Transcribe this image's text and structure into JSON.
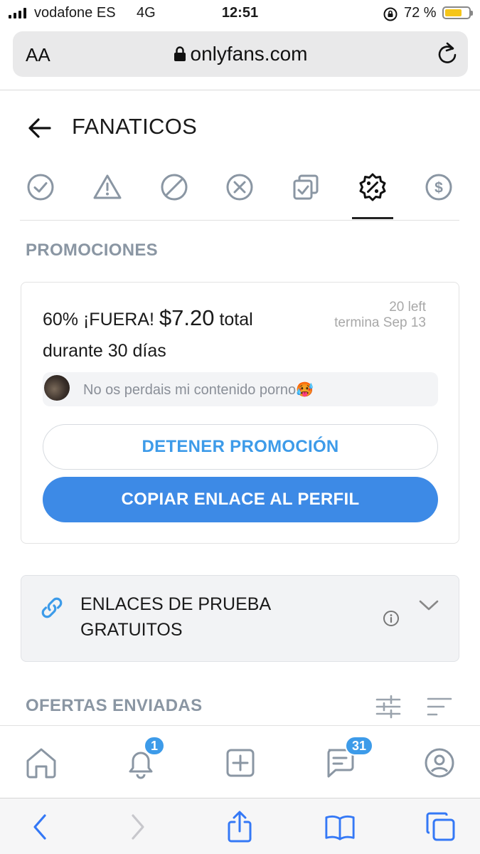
{
  "status_bar": {
    "carrier": "vodafone ES",
    "network": "4G",
    "time": "12:51",
    "battery_percent": "72 %",
    "battery_level": 0.72
  },
  "browser": {
    "text_size_label": "AA",
    "url": "onlyfans.com"
  },
  "header": {
    "title": "FANATICOS"
  },
  "tabs": [
    {
      "icon": "check-circle-icon",
      "active": false
    },
    {
      "icon": "warning-icon",
      "active": false
    },
    {
      "icon": "blocked-icon",
      "active": false
    },
    {
      "icon": "cancel-icon",
      "active": false
    },
    {
      "icon": "copy-check-icon",
      "active": false
    },
    {
      "icon": "discount-badge-icon",
      "active": true
    },
    {
      "icon": "dollar-circle-icon",
      "active": false
    }
  ],
  "promotions": {
    "section_label": "PROMOCIONES",
    "card": {
      "title_prefix": "60% ¡FUERA! ",
      "price": "$7.20",
      "title_suffix": " total durante 30 días",
      "remaining": "20 left",
      "ends": "termina Sep 13",
      "message": "No os perdais mi contenido porno🥵",
      "stop_button": "DETENER PROMOCIÓN",
      "copy_button": "COPIAR ENLACE AL PERFIL"
    }
  },
  "free_trial": {
    "label": "ENLACES DE PRUEBA GRATUITOS"
  },
  "offers": {
    "section_label": "OFERTAS ENVIADAS"
  },
  "app_nav": {
    "notifications_badge": "1",
    "messages_badge": "31"
  },
  "colors": {
    "accent": "#3d8ae6",
    "accent_text": "#3d9be9",
    "muted": "#8a96a3"
  }
}
